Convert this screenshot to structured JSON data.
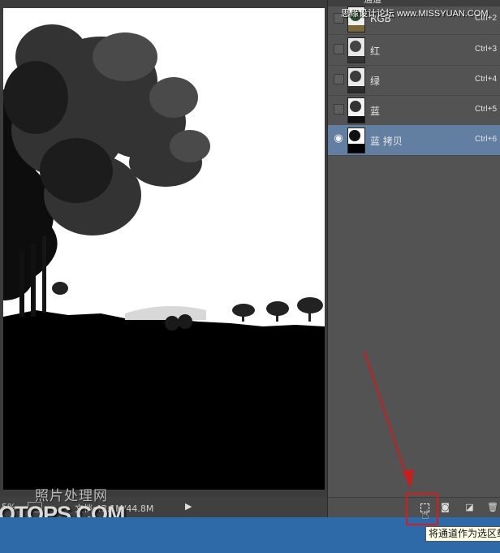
{
  "canvas": {
    "zoom": "5%",
    "doc_size": "文档:43.1M/44.8M"
  },
  "watermark": {
    "line1": "照片处理网",
    "line2": "OTOPS.COM"
  },
  "site_watermark": "思缘设计论坛 www.MISSYUAN.COM",
  "panel": {
    "header_text": "通道",
    "channels": [
      {
        "label": "RGB",
        "shortcut": "Ctrl+2",
        "visible": false,
        "selected": false
      },
      {
        "label": "红",
        "shortcut": "Ctrl+3",
        "visible": false,
        "selected": false
      },
      {
        "label": "绿",
        "shortcut": "Ctrl+4",
        "visible": false,
        "selected": false
      },
      {
        "label": "蓝",
        "shortcut": "Ctrl+5",
        "visible": false,
        "selected": false
      },
      {
        "label": "蓝 拷贝",
        "shortcut": "Ctrl+6",
        "visible": true,
        "selected": true
      }
    ]
  },
  "tooltip": "将通道作为选区载"
}
